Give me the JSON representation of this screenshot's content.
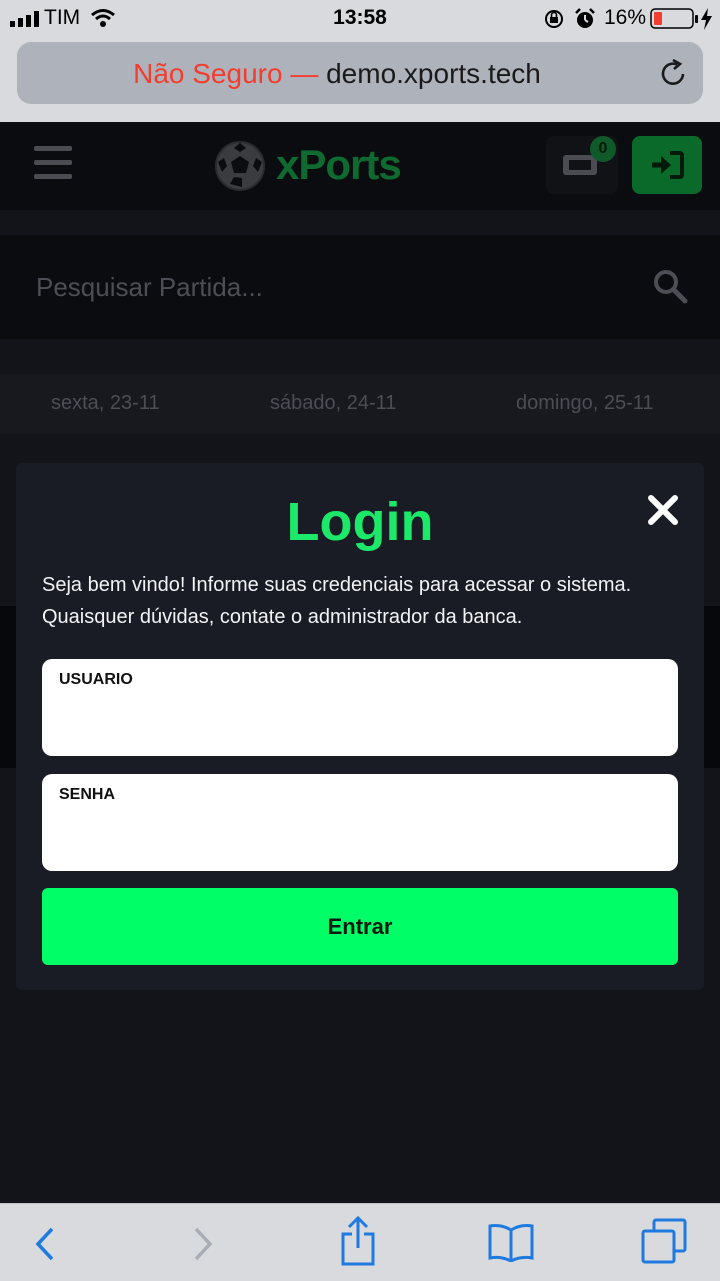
{
  "status_bar": {
    "carrier": "TIM",
    "time": "13:58",
    "battery_pct": "16%"
  },
  "browser": {
    "insecure_label": "Não Seguro —",
    "domain": "demo.xports.tech"
  },
  "header": {
    "logo_text": "xPorts",
    "ticket_count": "0"
  },
  "search": {
    "placeholder": "Pesquisar Partida..."
  },
  "dates": [
    "sexta, 23-11",
    "sábado, 24-11",
    "domingo, 25-11"
  ],
  "modal": {
    "title": "Login",
    "message": "Seja bem vindo! Informe suas credenciais para acessar o sistema. Quaisquer dúvidas, contate o administrador da banca.",
    "user_label": "USUARIO",
    "user_value": "",
    "pass_label": "SENHA",
    "pass_value": "",
    "submit_label": "Entrar"
  },
  "colors": {
    "accent": "#1ce96a",
    "button": "#00ff66",
    "insecure": "#f23d2f"
  }
}
